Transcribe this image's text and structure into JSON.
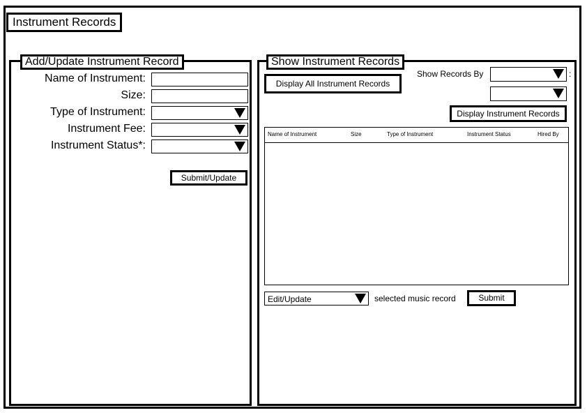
{
  "app_title": "Instrument Records",
  "left_panel": {
    "title": "Add/Update Instrument Record",
    "fields": [
      {
        "label": "Name of Instrument:"
      },
      {
        "label": "Size:"
      },
      {
        "label": "Type of Instrument:"
      },
      {
        "label": "Instrument Fee:"
      },
      {
        "label": "Instrument Status*:"
      }
    ],
    "submit_label": "Submit/Update"
  },
  "right_panel": {
    "title": "Show Instrument Records",
    "display_all_label": "Display All Instrument Records",
    "show_records_by_label": "Show Records By",
    "colon": ":",
    "display_records_label": "Display Instrument Records",
    "table_columns": [
      "Name of Instrument",
      "Size",
      "Type of Instrument",
      "Instrument Status",
      "Hired By"
    ],
    "action_select_value": "Edit/Update",
    "selected_text": "selected music record",
    "submit_label": "Submit"
  }
}
